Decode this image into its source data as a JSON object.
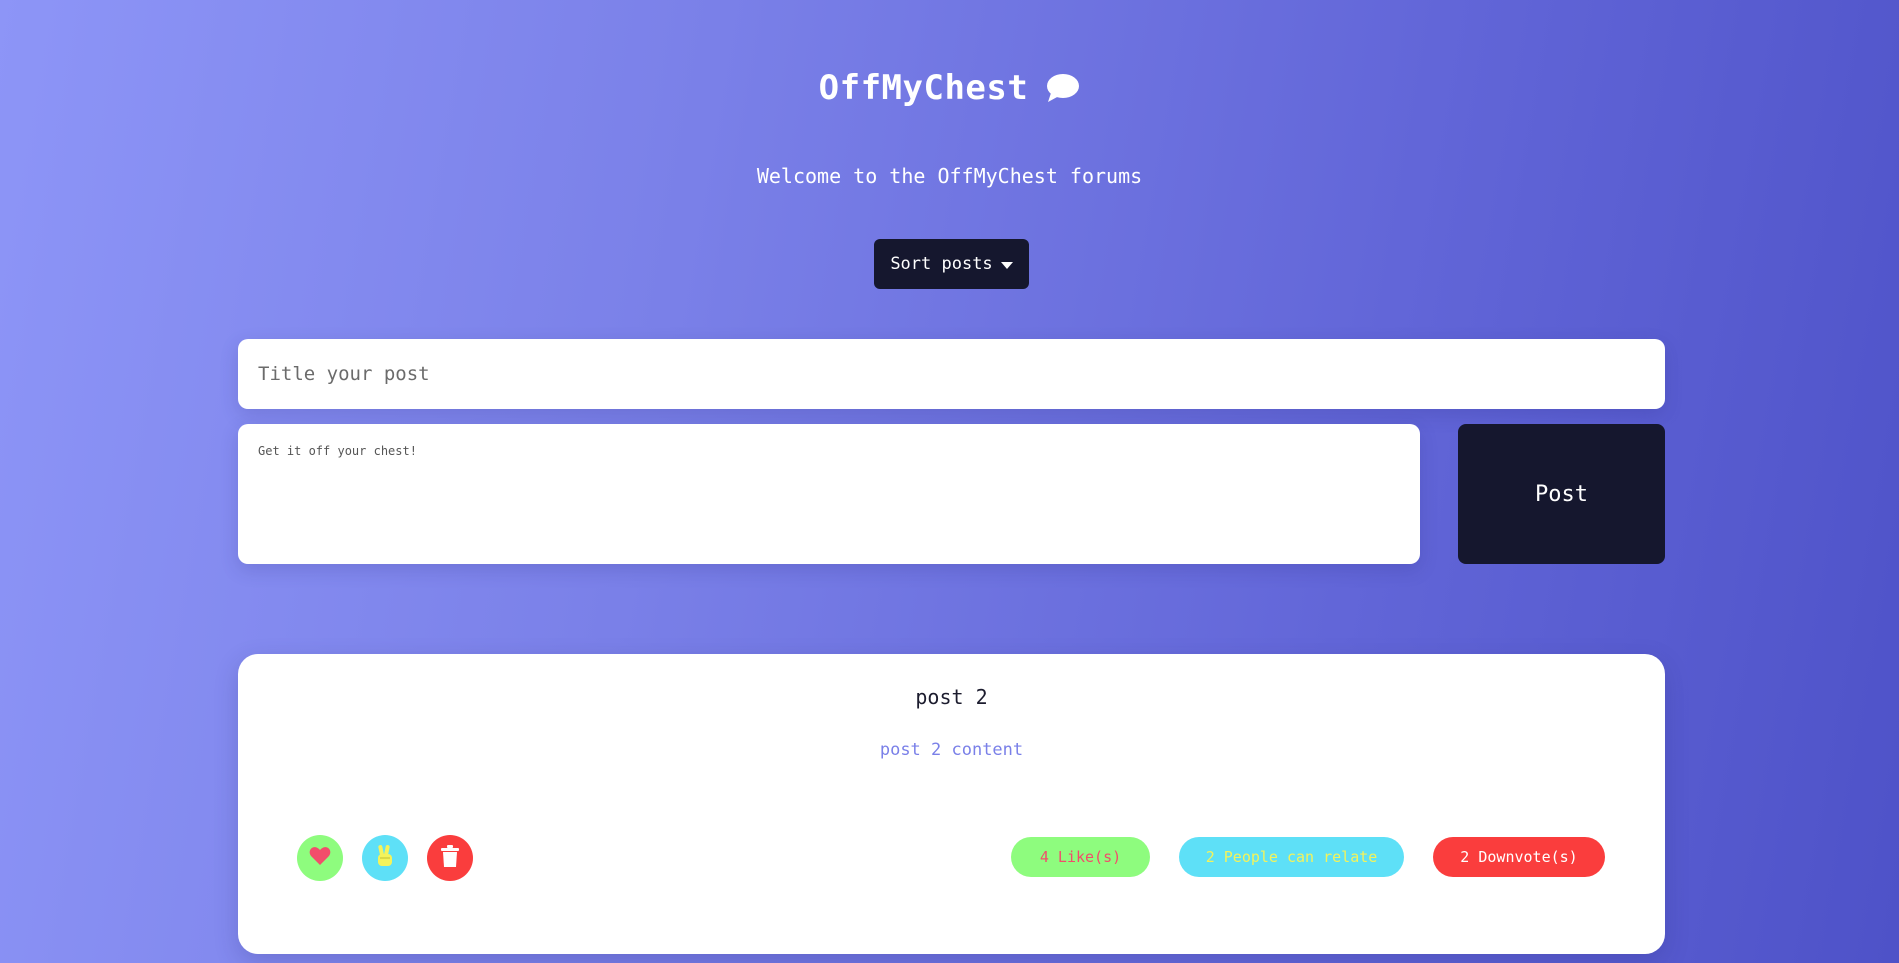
{
  "header": {
    "title": "OffMyChest",
    "title_icon": "chat-bubble-icon",
    "subtitle": "Welcome to the OffMyChest forums"
  },
  "sort": {
    "label": "Sort posts",
    "icon": "caret-down-icon"
  },
  "composer": {
    "title_placeholder": "Title your post",
    "title_value": "",
    "content_placeholder": "Get it off your chest!",
    "content_value": "",
    "post_label": "Post"
  },
  "posts": [
    {
      "title": "post 2",
      "content": "post 2 content",
      "actions": {
        "like_icon": "heart-icon",
        "relate_icon": "peace-hand-icon",
        "delete_icon": "trash-icon"
      },
      "likes_label": "4 Like(s)",
      "relate_label": "2 People can relate",
      "downvotes_label": "2 Downvote(s)"
    }
  ],
  "colors": {
    "background_start": "#8d95f7",
    "background_end": "#4e52c8",
    "dark": "#15172e",
    "like_green": "#8efc7e",
    "relate_cyan": "#5ee0f7",
    "delete_red": "#fa3d3d",
    "heart_red": "#f24d6b",
    "hand_yellow": "#f4f35a"
  }
}
